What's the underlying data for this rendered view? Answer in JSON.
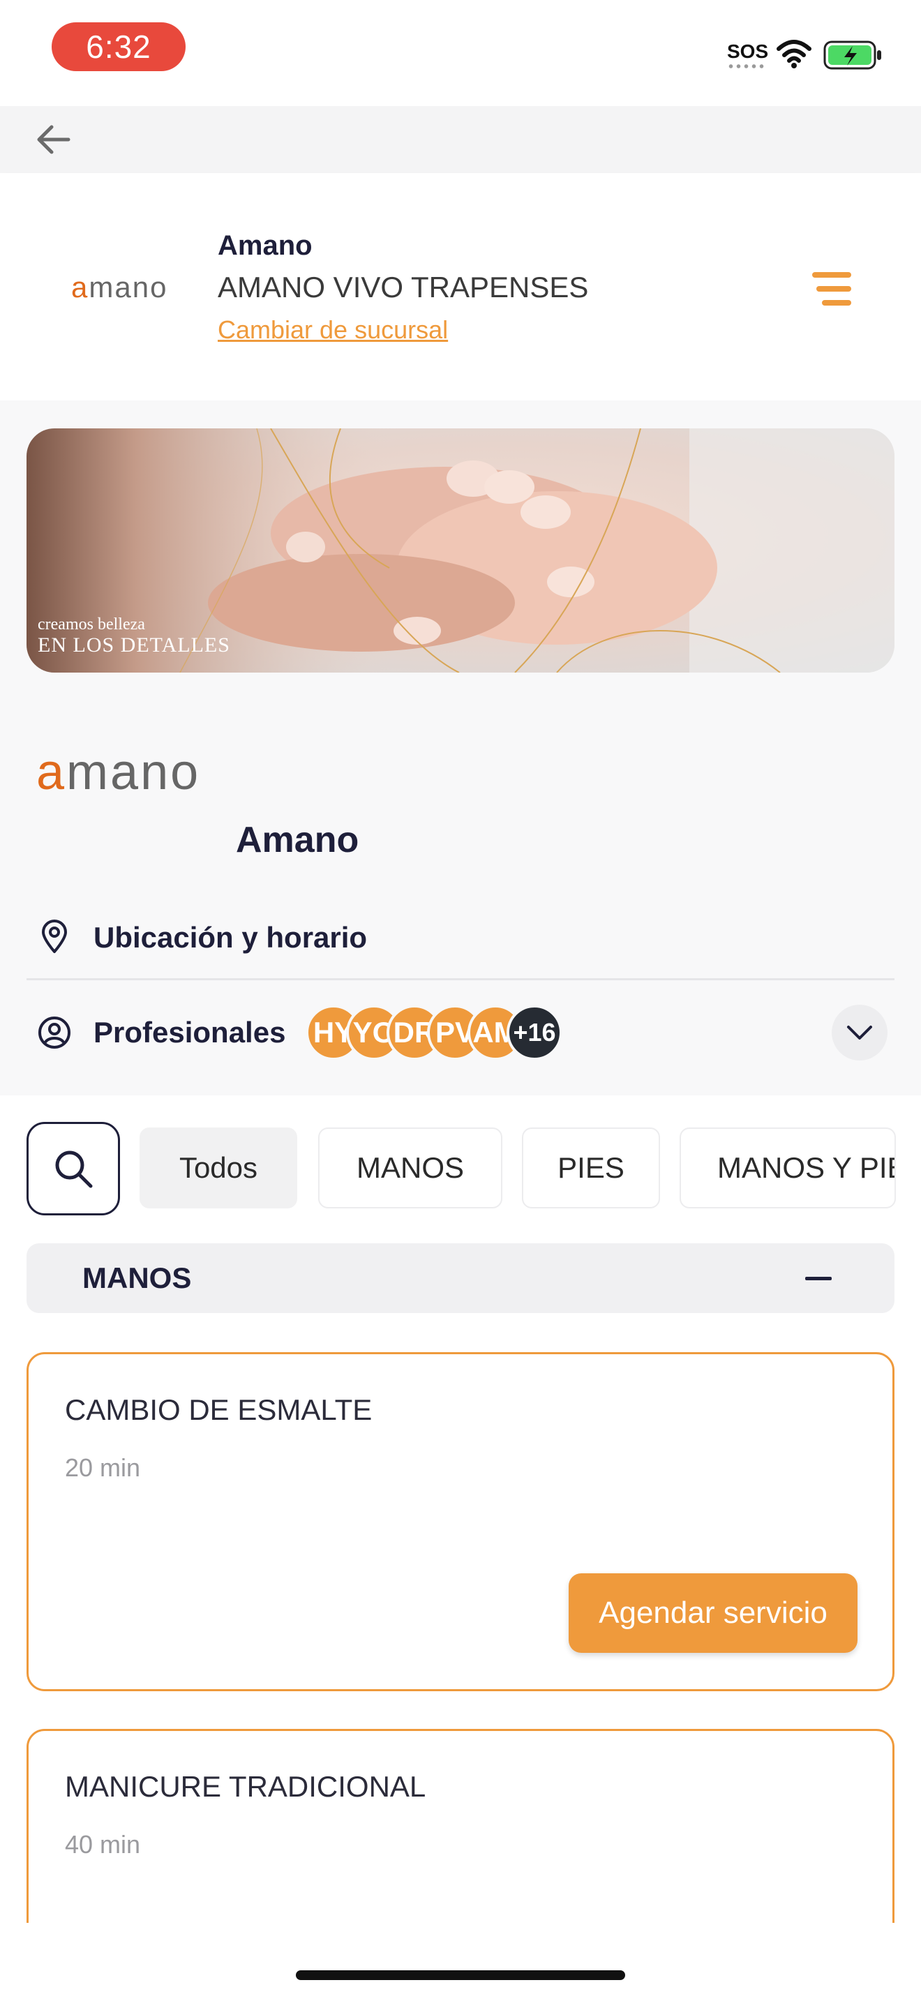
{
  "status_bar": {
    "time": "6:32",
    "sos": "SOS",
    "time_pill_color": "#e8493c",
    "battery_color": "#4cd964"
  },
  "header": {
    "logo_a": "a",
    "logo_rest": "mano",
    "business_name": "Amano",
    "branch_name": "AMANO VIVO TRAPENSES",
    "change_branch_link": "Cambiar de sucursal",
    "menu_icon": "menu-icon",
    "back_icon": "arrow-left-icon"
  },
  "banner": {
    "line1": "creamos belleza",
    "line2": "EN LOS DETALLES"
  },
  "business": {
    "logo_a": "a",
    "logo_rest": "mano",
    "name": "Amano",
    "location_label": "Ubicación y horario",
    "professionals_label": "Profesionales",
    "avatars": [
      "HY",
      "YO",
      "DR",
      "PV",
      "AM"
    ],
    "more_count": "+16"
  },
  "filters": {
    "chips": [
      "Todos",
      "MANOS",
      "PIES",
      "MANOS Y PIES"
    ],
    "active": "Todos"
  },
  "category": {
    "title": "MANOS",
    "services": [
      {
        "name": "CAMBIO DE ESMALTE",
        "duration": "20 min",
        "button": "Agendar servicio"
      },
      {
        "name": "MANICURE TRADICIONAL",
        "duration": "40 min"
      }
    ]
  },
  "colors": {
    "accent": "#ef9a3c",
    "dark": "#1e1f3a",
    "avatar_more": "#262b33"
  }
}
